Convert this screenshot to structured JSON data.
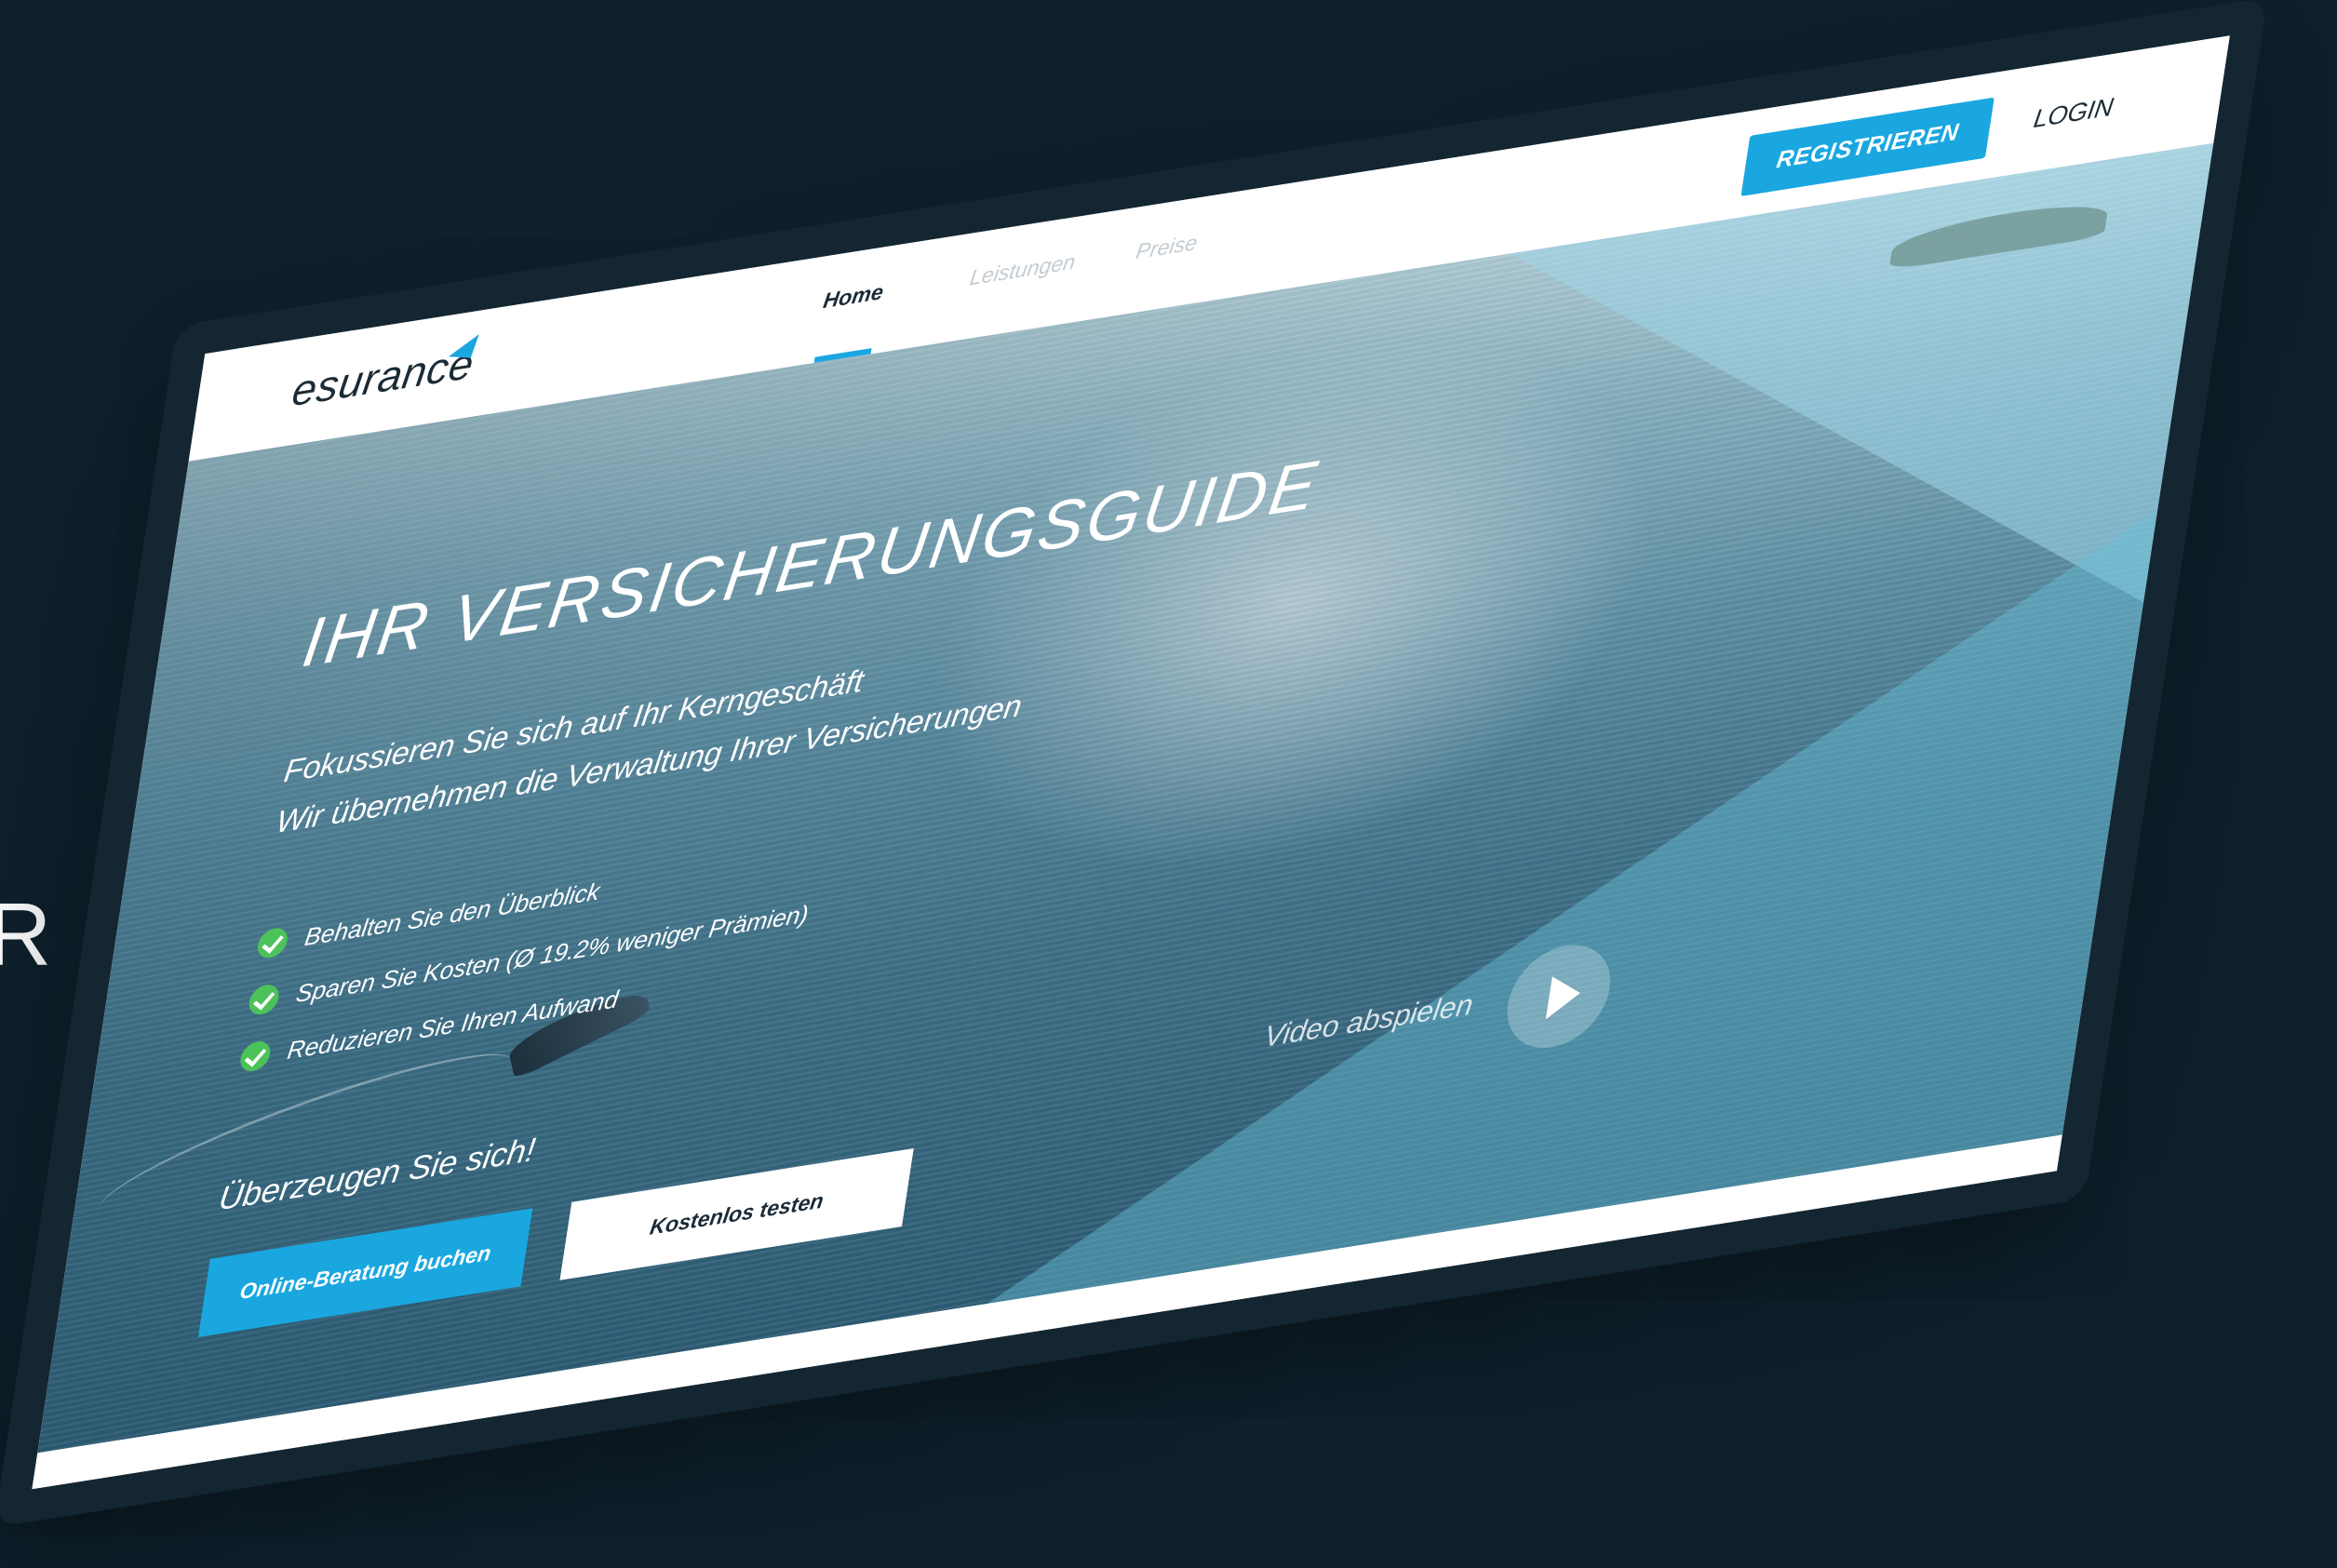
{
  "background_color": "#0f212d",
  "accent_color": "#1aa7e0",
  "edge_text": "R",
  "nav": {
    "logo": "esurance",
    "logo_icon": "arrow-mark-icon",
    "items": [
      {
        "label": "Home",
        "active": true
      },
      {
        "label": "Leistungen",
        "active": false
      },
      {
        "label": "Preise",
        "active": false
      }
    ],
    "register_label": "REGISTRIEREN",
    "login_label": "LOGIN"
  },
  "hero": {
    "title": "IHR VERSICHERUNGSGUIDE",
    "subtitle_line1": "Fokussieren Sie sich auf Ihr Kerngeschäft",
    "subtitle_line2": "Wir übernehmen die Verwaltung Ihrer Versicherungen",
    "bullets": [
      "Behalten Sie den Überblick",
      "Sparen Sie Kosten (Ø 19.2% weniger Prämien)",
      "Reduzieren Sie Ihren Aufwand"
    ],
    "cta_title": "Überzeugen Sie sich!",
    "primary_button": "Online-Beratung buchen",
    "secondary_button": "Kostenlos testen",
    "video_label": "Video abspielen",
    "video_icon": "play-icon"
  }
}
